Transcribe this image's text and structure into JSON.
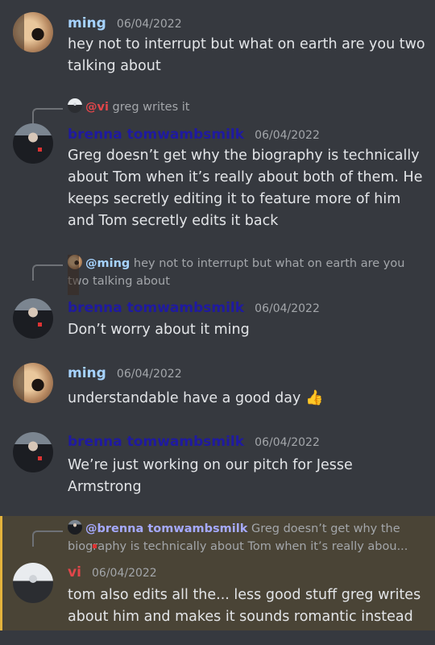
{
  "messages": [
    {
      "author": "ming",
      "timestamp": "06/04/2022",
      "text": "hey not to interrupt but what on earth are you two talking about"
    },
    {
      "reply": {
        "mention": "@vi",
        "preview": "greg writes it"
      },
      "author": "brenna tomwambsmilk",
      "timestamp": "06/04/2022",
      "text": "Greg doesn’t get why the biography is technically about Tom when it’s really about both of them. He keeps secretly editing it to feature more of him and Tom secretly edits it back"
    },
    {
      "reply": {
        "mention": "@ming",
        "preview": "hey not to interrupt but what on earth are you two talking about"
      },
      "author": "brenna tomwambsmilk",
      "timestamp": "06/04/2022",
      "text": "Don’t worry about it ming"
    },
    {
      "author": "ming",
      "timestamp": "06/04/2022",
      "text": "understandable have a good day",
      "emoji": "👍"
    },
    {
      "author": "brenna tomwambsmilk",
      "timestamp": "06/04/2022",
      "text": "We’re just working on our pitch for Jesse Armstrong"
    },
    {
      "reply": {
        "mention": "@brenna tomwambsmilk",
        "preview": "Greg doesn’t get why the biography is technically about Tom when it’s really abou..."
      },
      "author": "vi",
      "timestamp": "06/04/2022",
      "text": "tom also edits all the... less good stuff greg writes about him and makes it sounds romantic instead"
    }
  ],
  "colors": {
    "background": "#36393f",
    "ming": "#a6d3ff",
    "brenna": "#1f1aa0",
    "vi": "#e0464a",
    "highlight": "#4a4436",
    "highlight_bar": "#e4b33c"
  }
}
